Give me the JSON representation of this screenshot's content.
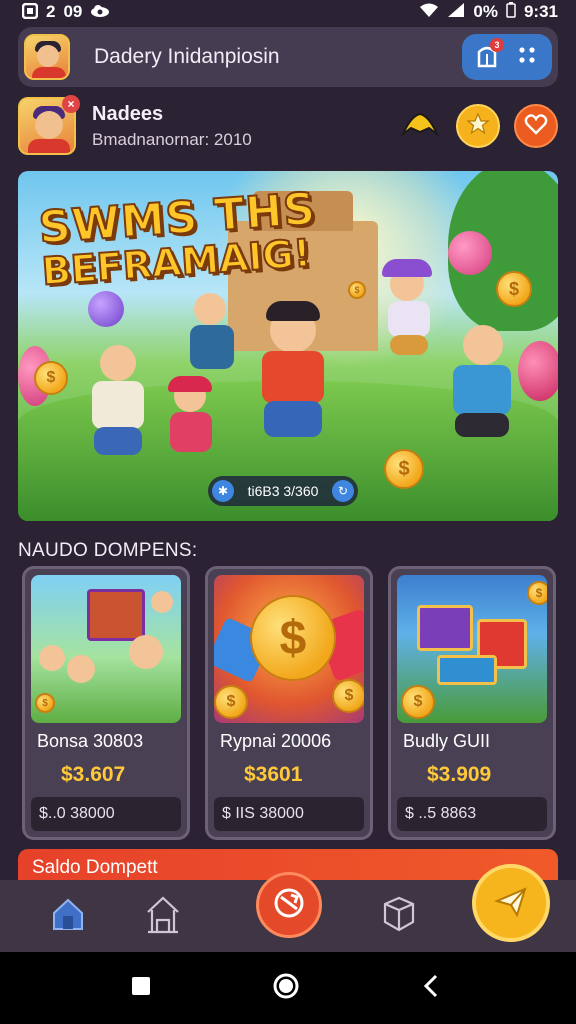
{
  "status_bar": {
    "left_items": [
      "2",
      "09"
    ],
    "battery": "0%",
    "time": "9:31"
  },
  "header": {
    "title": "Dadery Inidanpiosin",
    "icon_names": [
      "avatar",
      "notification-icon",
      "grid-icon"
    ],
    "notification_count": "3"
  },
  "profile": {
    "name": "Nadees",
    "subtitle": "Bmadnanornar: 2010",
    "action_icons": [
      "crown-icon",
      "star-icon",
      "heart-icon"
    ]
  },
  "hero": {
    "title_line1": "SWMS THS",
    "title_line2": "BEFRAMAIG!",
    "pill_text": "ti6B3 3/360"
  },
  "section": {
    "title": "NAUDO DOMPENS:"
  },
  "cards": [
    {
      "name": "Bonsa 30803",
      "price": "$3.607",
      "footer": "$..0 38000"
    },
    {
      "name": "Rypnai 20006",
      "price": "$3601",
      "footer": "$ IIS 38000"
    },
    {
      "name": "Budly GUII",
      "price": "$3.909",
      "footer": "$ ..5 8863"
    }
  ],
  "promo": {
    "label": "Saldo Dompett"
  },
  "bottom_nav": {
    "items": [
      "home-icon",
      "house-outline-icon",
      "refresh-icon",
      "box-icon",
      "plane-icon"
    ]
  },
  "colors": {
    "background": "#2b2233",
    "accent_gold": "#ffc93a",
    "accent_orange": "#e44a2a",
    "header_blue": "#3b77c9"
  }
}
